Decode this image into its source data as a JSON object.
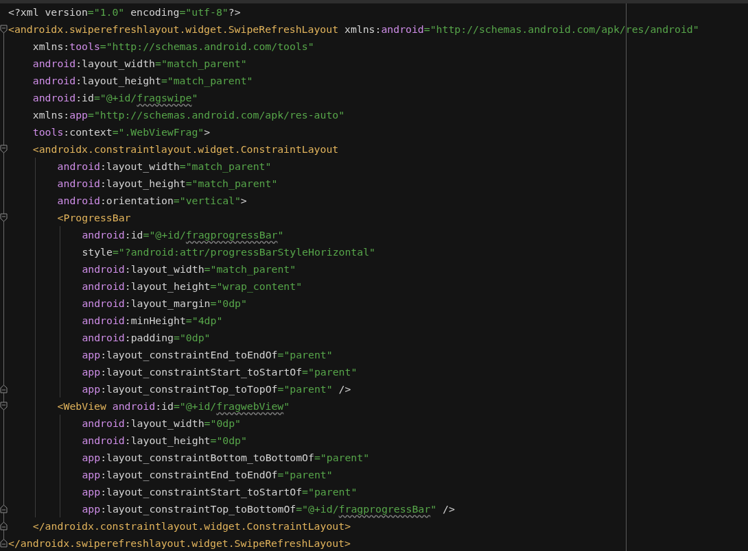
{
  "editor": {
    "lines": [
      {
        "kind": "plain",
        "tokens": [
          {
            "kind": "decl",
            "text": "<?xml version"
          },
          {
            "kind": "value",
            "text": "=\"1.0\""
          },
          {
            "kind": "decl",
            "text": " encoding"
          },
          {
            "kind": "value",
            "text": "=\"utf-8\""
          },
          {
            "kind": "decl",
            "text": "?>"
          }
        ]
      },
      {
        "kind": "fold_start",
        "tokens": [
          {
            "kind": "tag",
            "text": "<androidx.swiperefreshlayout.widget.SwipeRefreshLayout"
          },
          {
            "kind": "attr",
            "text": " xmlns:"
          },
          {
            "kind": "ns",
            "text": "android"
          },
          {
            "kind": "value",
            "text": "=\"http://schemas.android.com/apk/res/android\""
          }
        ],
        "children": [
          {
            "kind": "plain",
            "tokens": [
              {
                "kind": "attr",
                "text": "xmlns:"
              },
              {
                "kind": "ns",
                "text": "tools"
              },
              {
                "kind": "value",
                "text": "=\"http://schemas.android.com/tools\""
              }
            ]
          },
          {
            "kind": "plain",
            "tokens": [
              {
                "kind": "ns",
                "text": "android"
              },
              {
                "kind": "attr",
                "text": ":layout_width"
              },
              {
                "kind": "value",
                "text": "=\"match_parent\""
              }
            ]
          },
          {
            "kind": "plain",
            "tokens": [
              {
                "kind": "ns",
                "text": "android"
              },
              {
                "kind": "attr",
                "text": ":layout_height"
              },
              {
                "kind": "value",
                "text": "=\"match_parent\""
              }
            ]
          },
          {
            "kind": "plain",
            "tokens": [
              {
                "kind": "ns",
                "text": "android"
              },
              {
                "kind": "attr",
                "text": ":id"
              },
              {
                "kind": "value",
                "text": "=\"@+id/"
              },
              {
                "kind": "typo",
                "text": "fragswipe"
              },
              {
                "kind": "value",
                "text": "\""
              }
            ]
          },
          {
            "kind": "plain",
            "tokens": [
              {
                "kind": "attr",
                "text": "xmlns:"
              },
              {
                "kind": "ns",
                "text": "app"
              },
              {
                "kind": "value",
                "text": "=\"http://schemas.android.com/apk/res-auto\""
              }
            ]
          },
          {
            "kind": "plain",
            "tokens": [
              {
                "kind": "ns",
                "text": "tools"
              },
              {
                "kind": "attr",
                "text": ":context"
              },
              {
                "kind": "value",
                "text": "=\".WebViewFrag\""
              },
              {
                "kind": "attr",
                "text": ">"
              }
            ]
          },
          {
            "kind": "fold_start",
            "tokens": [
              {
                "kind": "tag",
                "text": "<androidx.constraintlayout.widget.ConstraintLayout"
              }
            ],
            "children": [
              {
                "kind": "plain",
                "tokens": [
                  {
                    "kind": "ns",
                    "text": "android"
                  },
                  {
                    "kind": "attr",
                    "text": ":layout_width"
                  },
                  {
                    "kind": "value",
                    "text": "=\"match_parent\""
                  }
                ]
              },
              {
                "kind": "plain",
                "tokens": [
                  {
                    "kind": "ns",
                    "text": "android"
                  },
                  {
                    "kind": "attr",
                    "text": ":layout_height"
                  },
                  {
                    "kind": "value",
                    "text": "=\"match_parent\""
                  }
                ]
              },
              {
                "kind": "plain",
                "tokens": [
                  {
                    "kind": "ns",
                    "text": "android"
                  },
                  {
                    "kind": "attr",
                    "text": ":orientation"
                  },
                  {
                    "kind": "value",
                    "text": "=\"vertical\""
                  },
                  {
                    "kind": "attr",
                    "text": ">"
                  }
                ]
              },
              {
                "kind": "fold_start",
                "tokens": [
                  {
                    "kind": "tag",
                    "text": "<ProgressBar"
                  }
                ],
                "children": [
                  {
                    "kind": "plain",
                    "tokens": [
                      {
                        "kind": "ns",
                        "text": "android"
                      },
                      {
                        "kind": "attr",
                        "text": ":id"
                      },
                      {
                        "kind": "value",
                        "text": "=\"@+id/"
                      },
                      {
                        "kind": "typo",
                        "text": "fragprogressBar"
                      },
                      {
                        "kind": "value",
                        "text": "\""
                      }
                    ]
                  },
                  {
                    "kind": "plain",
                    "tokens": [
                      {
                        "kind": "attr",
                        "text": "style"
                      },
                      {
                        "kind": "value",
                        "text": "=\"?android:attr/progressBarStyleHorizontal\""
                      }
                    ]
                  },
                  {
                    "kind": "plain",
                    "tokens": [
                      {
                        "kind": "ns",
                        "text": "android"
                      },
                      {
                        "kind": "attr",
                        "text": ":layout_width"
                      },
                      {
                        "kind": "value",
                        "text": "=\"match_parent\""
                      }
                    ]
                  },
                  {
                    "kind": "plain",
                    "tokens": [
                      {
                        "kind": "ns",
                        "text": "android"
                      },
                      {
                        "kind": "attr",
                        "text": ":layout_height"
                      },
                      {
                        "kind": "value",
                        "text": "=\"wrap_content\""
                      }
                    ]
                  },
                  {
                    "kind": "plain",
                    "tokens": [
                      {
                        "kind": "ns",
                        "text": "android"
                      },
                      {
                        "kind": "attr",
                        "text": ":layout_margin"
                      },
                      {
                        "kind": "value",
                        "text": "=\"0dp\""
                      }
                    ]
                  },
                  {
                    "kind": "plain",
                    "tokens": [
                      {
                        "kind": "ns",
                        "text": "android"
                      },
                      {
                        "kind": "attr",
                        "text": ":minHeight"
                      },
                      {
                        "kind": "value",
                        "text": "=\"4dp\""
                      }
                    ]
                  },
                  {
                    "kind": "plain",
                    "tokens": [
                      {
                        "kind": "ns",
                        "text": "android"
                      },
                      {
                        "kind": "attr",
                        "text": ":padding"
                      },
                      {
                        "kind": "value",
                        "text": "=\"0dp\""
                      }
                    ]
                  },
                  {
                    "kind": "plain",
                    "tokens": [
                      {
                        "kind": "ns",
                        "text": "app"
                      },
                      {
                        "kind": "attr",
                        "text": ":layout_constraintEnd_toEndOf"
                      },
                      {
                        "kind": "value",
                        "text": "=\"parent\""
                      }
                    ]
                  },
                  {
                    "kind": "plain",
                    "tokens": [
                      {
                        "kind": "ns",
                        "text": "app"
                      },
                      {
                        "kind": "attr",
                        "text": ":layout_constraintStart_toStartOf"
                      },
                      {
                        "kind": "value",
                        "text": "=\"parent\""
                      }
                    ]
                  },
                  {
                    "kind": "fold_end",
                    "tokens": [
                      {
                        "kind": "ns",
                        "text": "app"
                      },
                      {
                        "kind": "attr",
                        "text": ":layout_constraintTop_toTopOf"
                      },
                      {
                        "kind": "value",
                        "text": "=\"parent\""
                      },
                      {
                        "kind": "attr",
                        "text": " />"
                      }
                    ]
                  }
                ]
              },
              {
                "kind": "fold_start",
                "tokens": [
                  {
                    "kind": "tag",
                    "text": "<WebView "
                  },
                  {
                    "kind": "ns",
                    "text": "android"
                  },
                  {
                    "kind": "attr",
                    "text": ":id"
                  },
                  {
                    "kind": "value",
                    "text": "=\"@+id/"
                  },
                  {
                    "kind": "typo",
                    "text": "fragwebView"
                  },
                  {
                    "kind": "value",
                    "text": "\""
                  }
                ],
                "children": [
                  {
                    "kind": "plain",
                    "tokens": [
                      {
                        "kind": "ns",
                        "text": "android"
                      },
                      {
                        "kind": "attr",
                        "text": ":layout_width"
                      },
                      {
                        "kind": "value",
                        "text": "=\"0dp\""
                      }
                    ]
                  },
                  {
                    "kind": "plain",
                    "tokens": [
                      {
                        "kind": "ns",
                        "text": "android"
                      },
                      {
                        "kind": "attr",
                        "text": ":layout_height"
                      },
                      {
                        "kind": "value",
                        "text": "=\"0dp\""
                      }
                    ]
                  },
                  {
                    "kind": "plain",
                    "tokens": [
                      {
                        "kind": "ns",
                        "text": "app"
                      },
                      {
                        "kind": "attr",
                        "text": ":layout_constraintBottom_toBottomOf"
                      },
                      {
                        "kind": "value",
                        "text": "=\"parent\""
                      }
                    ]
                  },
                  {
                    "kind": "plain",
                    "tokens": [
                      {
                        "kind": "ns",
                        "text": "app"
                      },
                      {
                        "kind": "attr",
                        "text": ":layout_constraintEnd_toEndOf"
                      },
                      {
                        "kind": "value",
                        "text": "=\"parent\""
                      }
                    ]
                  },
                  {
                    "kind": "plain",
                    "tokens": [
                      {
                        "kind": "ns",
                        "text": "app"
                      },
                      {
                        "kind": "attr",
                        "text": ":layout_constraintStart_toStartOf"
                      },
                      {
                        "kind": "value",
                        "text": "=\"parent\""
                      }
                    ]
                  },
                  {
                    "kind": "fold_end",
                    "tokens": [
                      {
                        "kind": "ns",
                        "text": "app"
                      },
                      {
                        "kind": "attr",
                        "text": ":layout_constraintTop_toBottomOf"
                      },
                      {
                        "kind": "value",
                        "text": "=\"@+id/"
                      },
                      {
                        "kind": "typo",
                        "text": "fragprogressBar"
                      },
                      {
                        "kind": "value",
                        "text": "\""
                      },
                      {
                        "kind": "attr",
                        "text": " />"
                      }
                    ]
                  }
                ]
              }
            ]
          },
          {
            "kind": "fold_end",
            "tokens": [
              {
                "kind": "tag",
                "text": "</androidx.constraintlayout.widget.ConstraintLayout>"
              }
            ]
          }
        ]
      },
      {
        "kind": "fold_end",
        "tokens": [
          {
            "kind": "tag",
            "text": "</androidx.swiperefreshlayout.widget.SwipeRefreshLayout>"
          }
        ]
      }
    ]
  }
}
